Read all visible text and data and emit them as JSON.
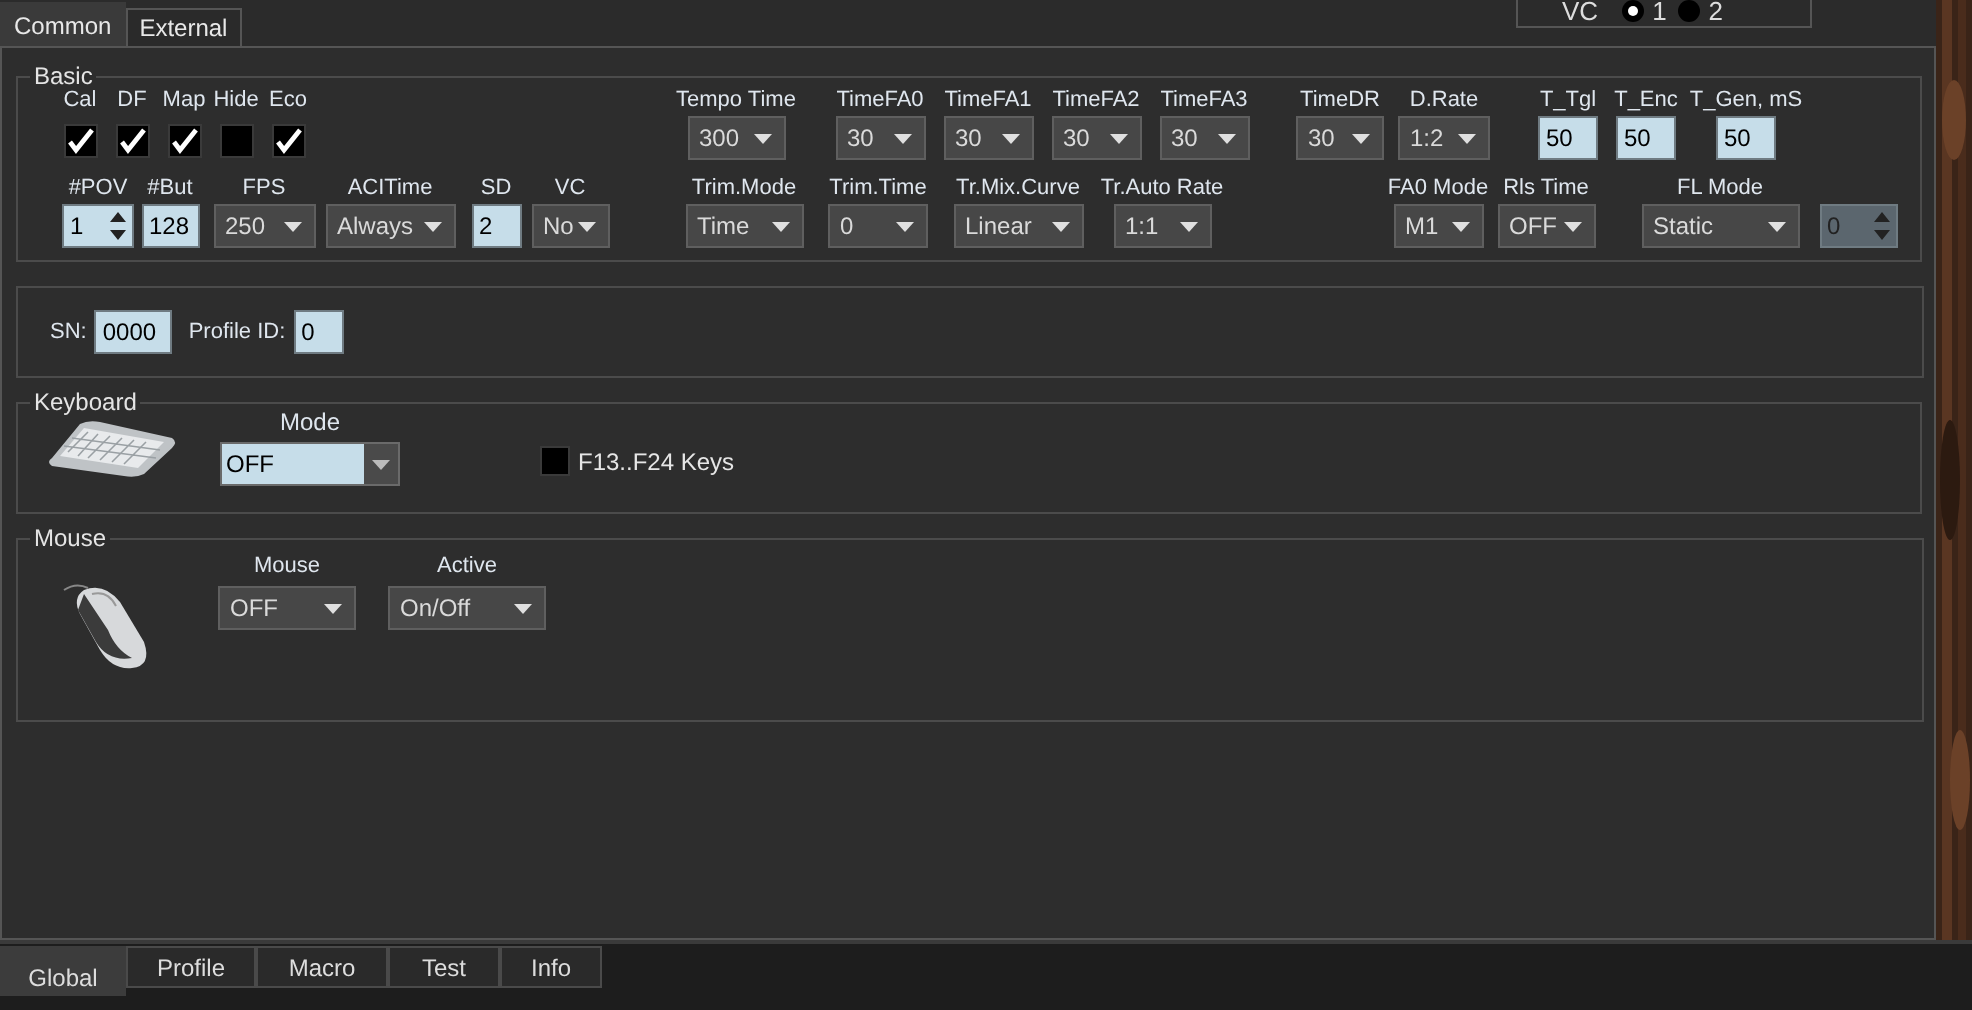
{
  "tabs": [
    {
      "label": "Common",
      "selected": true
    },
    {
      "label": "External",
      "selected": false
    }
  ],
  "vc_selector": {
    "label": "VC",
    "options": [
      {
        "label": "1",
        "selected": true
      },
      {
        "label": "2",
        "selected": false
      }
    ]
  },
  "basic": {
    "title": "Basic",
    "row_1": [
      {
        "kind": "checkbox",
        "label": "Cal",
        "checked": true
      },
      {
        "kind": "checkbox",
        "label": "DF",
        "checked": true
      },
      {
        "kind": "checkbox",
        "label": "Map",
        "checked": true
      },
      {
        "kind": "checkbox",
        "label": "Hide",
        "checked": false
      },
      {
        "kind": "checkbox",
        "label": "Eco",
        "checked": true
      },
      {
        "kind": "dropdown",
        "label": "Tempo Time",
        "value": "300"
      },
      {
        "kind": "dropdown",
        "label": "TimeFA0",
        "value": "30"
      },
      {
        "kind": "dropdown",
        "label": "TimeFA1",
        "value": "30"
      },
      {
        "kind": "dropdown",
        "label": "TimeFA2",
        "value": "30"
      },
      {
        "kind": "dropdown",
        "label": "TimeFA3",
        "value": "30"
      },
      {
        "kind": "dropdown",
        "label": "TimeDR",
        "value": "30"
      },
      {
        "kind": "dropdown",
        "label": "D.Rate",
        "value": "1:2"
      },
      {
        "kind": "field",
        "label": "T_Tgl",
        "value": "50"
      },
      {
        "kind": "field",
        "label": "T_Enc",
        "value": "50"
      },
      {
        "kind": "field",
        "label": "T_Gen, mS",
        "value": "50"
      }
    ],
    "row_2": [
      {
        "kind": "spinner",
        "label": "#POV",
        "value": "1",
        "disabled": false
      },
      {
        "kind": "field",
        "label": "#But",
        "value": "128"
      },
      {
        "kind": "dropdown",
        "label": "FPS",
        "value": "250"
      },
      {
        "kind": "dropdown",
        "label": "ACITime",
        "value": "Always"
      },
      {
        "kind": "field",
        "label": "SD",
        "value": "2"
      },
      {
        "kind": "dropdown",
        "label": "VC",
        "value": "No"
      },
      {
        "kind": "dropdown",
        "label": "Trim.Mode",
        "value": "Time"
      },
      {
        "kind": "dropdown",
        "label": "Trim.Time",
        "value": "0"
      },
      {
        "kind": "dropdown",
        "label": "Tr.Mix.Curve",
        "value": "Linear"
      },
      {
        "kind": "dropdown",
        "label": "Tr.Auto Rate",
        "value": "1:1"
      },
      {
        "kind": "dropdown",
        "label": "FA0 Mode",
        "value": "M1"
      },
      {
        "kind": "dropdown",
        "label": "Rls Time",
        "value": "OFF"
      },
      {
        "kind": "dropdown",
        "label": "FL Mode",
        "value": "Static"
      },
      {
        "kind": "spinner",
        "value": "0",
        "disabled": true
      }
    ]
  },
  "serial": [
    {
      "label": "SN:",
      "value": "0000"
    },
    {
      "label": "Profile ID:",
      "value": "0"
    }
  ],
  "keyboard": {
    "title": "Keyboard",
    "mode": {
      "label": "Mode",
      "value": "OFF"
    },
    "f_keys": {
      "label": "F13..F24 Keys",
      "checked": false
    }
  },
  "mouse": {
    "title": "Mouse",
    "controls": [
      {
        "label": "Mouse",
        "value": "OFF"
      },
      {
        "label": "Active",
        "value": "On/Off"
      }
    ]
  },
  "bottom_tabs": [
    {
      "label": "Global",
      "selected": true
    },
    {
      "label": "Profile",
      "selected": false
    },
    {
      "label": "Macro",
      "selected": false
    },
    {
      "label": "Test",
      "selected": false
    },
    {
      "label": "Info",
      "selected": false
    }
  ]
}
